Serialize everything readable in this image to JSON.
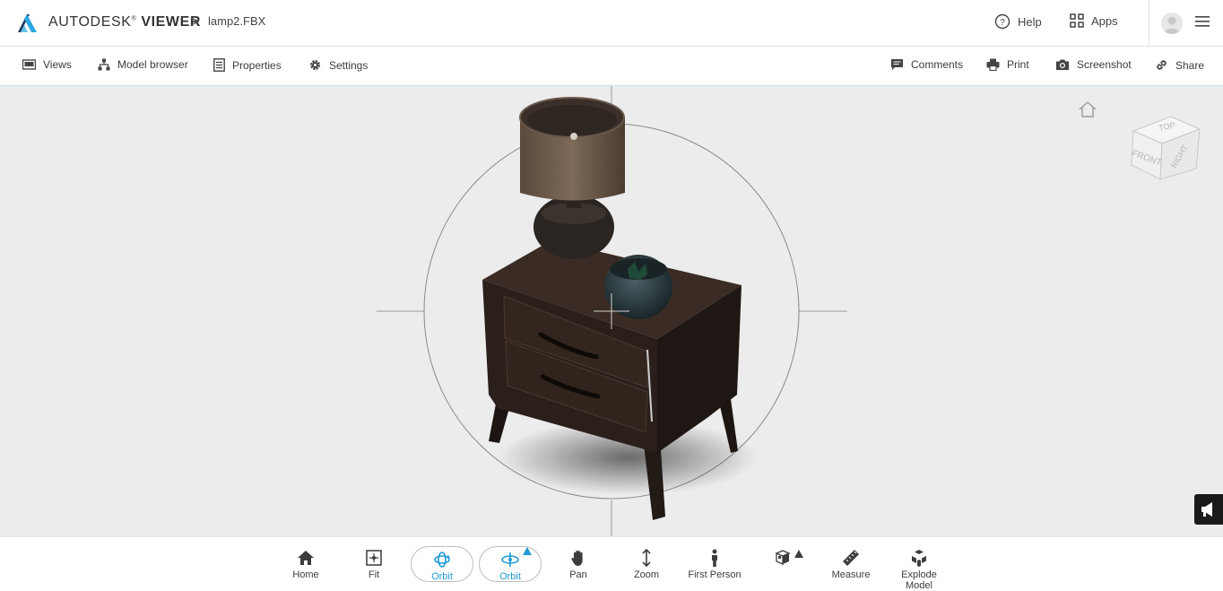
{
  "header": {
    "brand_part1": "AUTODESK",
    "brand_part2": "VIEWER",
    "separator": ">",
    "file_name": "lamp2.FBX",
    "help_label": "Help",
    "apps_label": "Apps"
  },
  "toolbar": {
    "views_label": "Views",
    "model_browser_label": "Model browser",
    "properties_label": "Properties",
    "settings_label": "Settings",
    "comments_label": "Comments",
    "print_label": "Print",
    "screenshot_label": "Screenshot",
    "share_label": "Share"
  },
  "viewcube": {
    "top_label": "TOP",
    "front_label": "FRONT",
    "right_label": "RIGHT"
  },
  "bottom_tools": {
    "home": "Home",
    "fit": "Fit",
    "orbit": "Orbit",
    "orbit_free": "Orbit",
    "pan": "Pan",
    "zoom": "Zoom",
    "first_person": "First Person",
    "measure": "Measure",
    "explode": "Explode Model"
  },
  "colors": {
    "accent": "#1e9ad6",
    "viewport_bg": "#ececec",
    "logo_blue": "#2aa7df",
    "logo_dark": "#1b3a5c"
  }
}
